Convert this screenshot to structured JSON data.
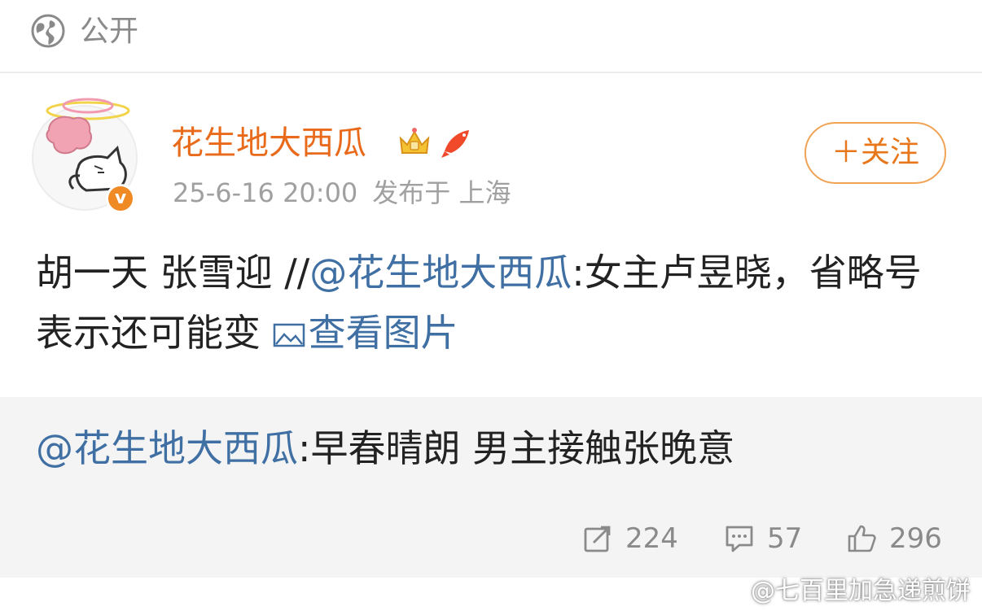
{
  "visibility": {
    "label": "公开",
    "icon": "globe-icon"
  },
  "author": {
    "name": "花生地大西瓜",
    "verified_mark": "v",
    "timestamp": "25-6-16 20:00",
    "source": "发布于 上海",
    "badges": [
      "crown-icon",
      "koi-fish-icon"
    ]
  },
  "follow": {
    "label": "＋关注"
  },
  "post": {
    "prefix": "胡一天 张雪迎 //",
    "mention": "@花生地大西瓜",
    "text": ":女主卢昱晓，省略号表示还可能变",
    "image_link": "查看图片"
  },
  "repost": {
    "mention": "@花生地大西瓜",
    "text": ":早春晴朗 男主接触张晚意"
  },
  "stats": {
    "reposts": "224",
    "comments": "57",
    "likes": "296"
  },
  "watermark": {
    "text": "@七百里加急递煎饼"
  },
  "colors": {
    "accent": "#e86a1a",
    "link": "#3f6fa3",
    "muted": "#8a8a8a",
    "repost_bg": "#f4f4f4"
  }
}
